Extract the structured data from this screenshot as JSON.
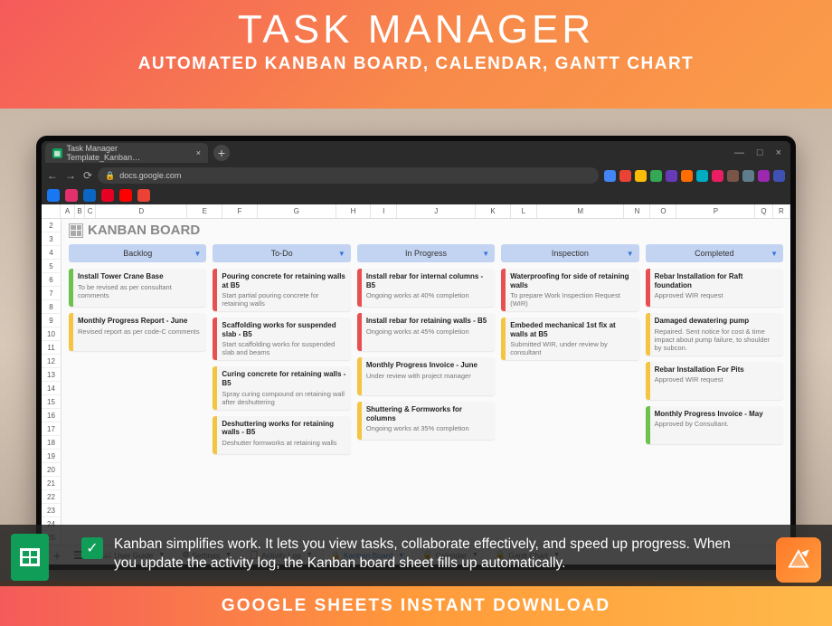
{
  "hero": {
    "title": "TASK MANAGER",
    "subtitle": "AUTOMATED KANBAN BOARD, CALENDAR, GANTT CHART"
  },
  "browser": {
    "tab_title": "Task Manager Template_Kanban…",
    "url": "docs.google.com"
  },
  "spreadsheet": {
    "columns": [
      "A",
      "B",
      "C",
      "D",
      "E",
      "F",
      "G",
      "H",
      "I",
      "J",
      "K",
      "L",
      "M",
      "N",
      "O",
      "P",
      "Q",
      "R"
    ],
    "rows": [
      "2",
      "3",
      "4",
      "5",
      "6",
      "7",
      "8",
      "9",
      "10",
      "11",
      "12",
      "13",
      "14",
      "15",
      "16",
      "17",
      "18",
      "19",
      "20",
      "21",
      "22",
      "23",
      "24",
      "25"
    ],
    "title": "KANBAN BOARD",
    "kanban_columns": [
      {
        "name": "Backlog",
        "cards": [
          {
            "title": "Install Tower Crane Base",
            "desc": "To be revised as per consultant comments",
            "color": "#6cc24a"
          },
          {
            "title": "Monthly Progress Report - June",
            "desc": "Revised report as per code-C comments",
            "color": "#f5c542"
          }
        ]
      },
      {
        "name": "To-Do",
        "cards": [
          {
            "title": "Pouring concrete for retaining walls at B5",
            "desc": "Start partial pouring concrete for retaining walls",
            "color": "#e85050"
          },
          {
            "title": "Scaffolding works for suspended slab - B5",
            "desc": "Start scaffolding works for suspended slab and beams",
            "color": "#e85050"
          },
          {
            "title": "Curing concrete for retaining walls - B5",
            "desc": "Spray curing compound on retaining wall after deshuttering",
            "color": "#f5c542"
          },
          {
            "title": "Deshuttering works for retaining walls - B5",
            "desc": "Deshutter formworks at retaining walls",
            "color": "#f5c542"
          }
        ]
      },
      {
        "name": "In Progress",
        "cards": [
          {
            "title": "Install rebar for internal columns - B5",
            "desc": "Ongoing works at 40% completion",
            "color": "#e85050"
          },
          {
            "title": "Install rebar for retaining walls - B5",
            "desc": "Ongoing works at 45% completion",
            "color": "#e85050"
          },
          {
            "title": "Monthly Progress Invoice - June",
            "desc": "Under review with project manager",
            "color": "#f5c542"
          },
          {
            "title": "Shuttering & Formworks for columns",
            "desc": "Ongoing works at 35% completion",
            "color": "#f5c542"
          }
        ]
      },
      {
        "name": "Inspection",
        "cards": [
          {
            "title": "Waterproofing for side of retaining walls",
            "desc": "To prepare Work Inspection Request (WIR)",
            "color": "#e85050"
          },
          {
            "title": "Embeded mechanical 1st fix at walls at B5",
            "desc": "Submitted WIR, under review by consultant",
            "color": "#f5c542"
          }
        ]
      },
      {
        "name": "Completed",
        "cards": [
          {
            "title": "Rebar Installation for Raft foundation",
            "desc": "Approved WIR request",
            "color": "#e85050"
          },
          {
            "title": "Damaged dewatering pump",
            "desc": "Repaired. Sent notice for cost & time impact about pump failure, to shoulder by subcon.",
            "color": "#f5c542"
          },
          {
            "title": "Rebar Installation For Pits",
            "desc": "Approved WIR request",
            "color": "#f5c542"
          },
          {
            "title": "Monthly Progress Invoice - May",
            "desc": "Approved by Consultant.",
            "color": "#6cc24a"
          }
        ]
      }
    ],
    "tabs": [
      {
        "label": "User Guide",
        "icon": "📖"
      },
      {
        "label": "Settings",
        "icon": "⚙"
      },
      {
        "label": "Activity Log",
        "icon": "📋"
      },
      {
        "label": "Kanban Board",
        "icon": "🔒",
        "active": true
      },
      {
        "label": "Calendar",
        "icon": "🔒"
      },
      {
        "label": "Gantt Chart",
        "icon": "🔒"
      }
    ]
  },
  "caption": "Kanban simplifies work. It lets you view tasks, collaborate effectively, and speed up progress. When you update the activity log, the Kanban board sheet fills up automatically.",
  "footer": "GOOGLE SHEETS INSTANT DOWNLOAD"
}
